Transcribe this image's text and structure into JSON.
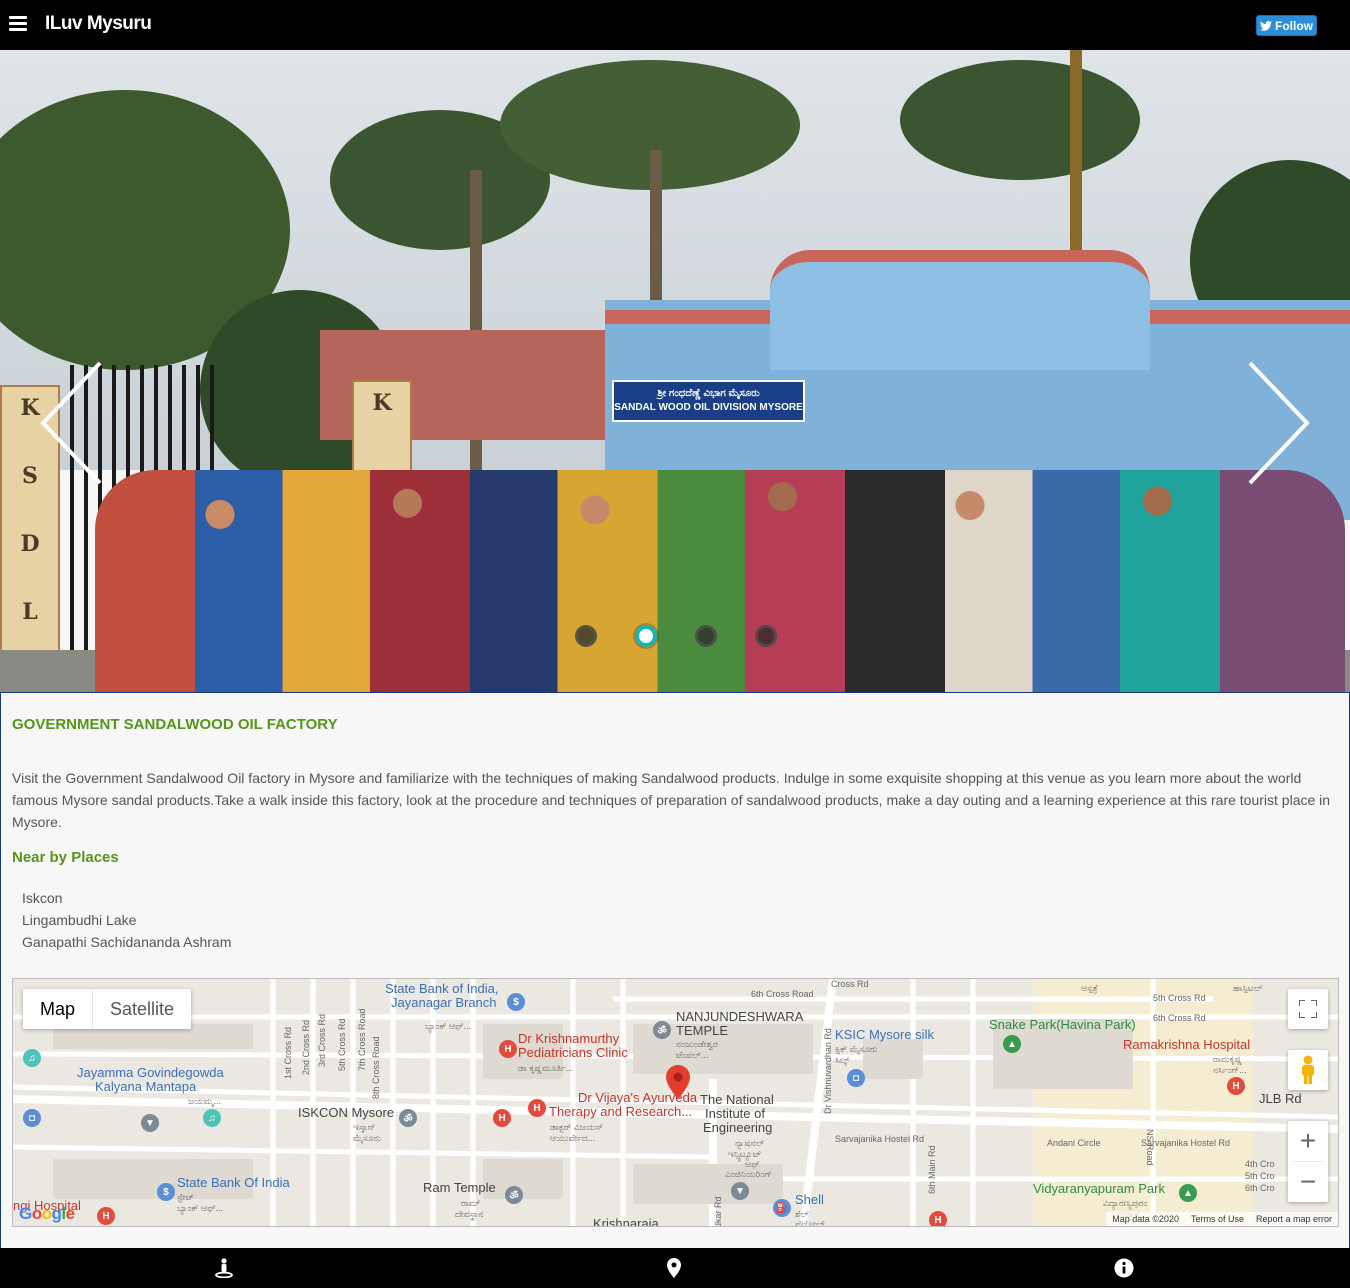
{
  "header": {
    "app_title": "ILuv Mysuru",
    "menu_icon": "hamburger-icon",
    "follow_label": "Follow",
    "follow_icon": "twitter-bird-icon",
    "follow_color": "#2a8fd8"
  },
  "carousel": {
    "sign_line1": "ಶ್ರೀ ಗಂಧದೆಣ್ಣೆ ವಿಭಾಗ ಮೈಸೂರು",
    "sign_line2": "SANDAL WOOD OIL DIVISION MYSORE",
    "pillar_letters": [
      "K",
      "S",
      "D",
      "L"
    ],
    "pillar_letter_right": "K",
    "slide_count": 4,
    "active_slide": 2,
    "accent_color": "#17b4b4"
  },
  "place": {
    "title": "GOVERNMENT SANDALWOOD OIL FACTORY",
    "description": "Visit the Government Sandalwood Oil factory in Mysore and familiarize with the techniques of making Sandalwood products. Indulge in some exquisite shopping at this venue as you learn more about the world famous Mysore sandal products.Take a walk inside this factory, look at the procedure and techniques of preparation of sandalwood products, make a day outing and a learning experience at this rare tourist place in Mysore.",
    "heading_color": "#55951a"
  },
  "nearby": {
    "title": "Near by Places",
    "items": [
      "Iskcon",
      "Lingambudhi Lake",
      "Ganapathi Sachidananda Ashram"
    ]
  },
  "map": {
    "type_map": "Map",
    "type_satellite": "Satellite",
    "zoom_in": "+",
    "zoom_out": "−",
    "footer_data": "Map data ©2020",
    "footer_terms": "Terms of Use",
    "footer_report": "Report a map error",
    "labels": {
      "sbi_jayanagar": "State Bank of India,",
      "sbi_jayanagar2": "Jayanagar Branch",
      "sbi_jayanagar_kn": "ಬ್ಯಾಂಕ್ ಆಫ್...",
      "krishnamurthy1": "Dr Krishnamurthy",
      "krishnamurthy2": "Pediatricians Clinic",
      "krishnamurthy_kn": "ಡಾ ಕೃಷ್ಣಮೂರ್ತಿ...",
      "nanjundeshwara1": "NANJUNDESHWARA",
      "nanjundeshwara2": "TEMPLE",
      "nanjundeshwara_kn1": "ನಂಜುಂಡೇಶ್ವರ",
      "nanjundeshwara_kn2": "ಟೆಂಪಲ್...",
      "ksic1": "KSIC Mysore silk",
      "ksic_kn1": "ಕ್ಸಿಕ್ ಮೈಸೂರು",
      "ksic_kn2": "ಸಿಲ್ಕ್",
      "snake_park": "Snake Park(Havina Park)",
      "ramakrishna": "Ramakrishna Hospital",
      "ramakrishna_kn1": "ರಾಮಕೃಷ್ಣ",
      "ramakrishna_kn2": "ನರ್ಸಿಂಗ್...",
      "jayamma1": "Jayamma Govindegowda",
      "jayamma2": "Kalyana Mantapa",
      "jayamma_kn": "ಜಯಮ್ಮ...",
      "iskcon": "ISKCON Mysore",
      "iskcon_kn1": "ಇಸ್ಕಾನ್",
      "iskcon_kn2": "ಮೈಸೂರು",
      "vijaya1": "Dr Vijaya's Ayurveda",
      "vijaya2": "Therapy and Research...",
      "vijaya_kn1": "ಡಾಕ್ಟರ್ ವಿಜಯಸ್",
      "vijaya_kn2": "ಆಯುರ್ವೇದ...",
      "nie1": "The National",
      "nie2": "Institute of",
      "nie3": "Engineering",
      "nie_kn1": "ನ್ಯಾಷನಲ್",
      "nie_kn2": "ಇನ್ಸ್ಟಿಟ್ಯೂಟ್",
      "nie_kn3": "ಆಫ್",
      "nie_kn4": "ಎಂಜಿನಿಯರಿಂಗ್",
      "jlb": "JLB Rd",
      "sarvajanika1": "Sarvajanika Hostel Rd",
      "sarvajanika2": "Sarvajanika Hostel Rd",
      "andani": "Andani Circle",
      "sbi2": "State Bank Of India",
      "sbi2_kn1": "ಸ್ಟೇಟ್",
      "sbi2_kn2": "ಬ್ಯಾಂಕ್ ಆಫ್...",
      "ram_temple": "Ram Temple",
      "ram_temple_kn1": "ರಾಮ್",
      "ram_temple_kn2": "ದೇವಸ್ಥಾನ",
      "shell": "Shell",
      "shell_kn1": "ಶೆಲ್",
      "shell_kn2": "ಪೆಟ್ರೋಲ್...",
      "vidyaranyapuram": "Vidyaranyapuram Park",
      "vidyaranyapuram_kn": "ವಿದ್ಯಾರಣ್ಯಪುರಂ",
      "vidyaranyapuram_kn2": "ಉದ್ಯಾನ",
      "krishnaraja": "Krishnaraja",
      "hospital_left": "ngi Hospital",
      "road_6th_cross": "6th Cross Road",
      "road_6th_cross_rd": "6th Cross Rd",
      "road_5th_cross": "5th Cross Rd",
      "road_1st_cross": "1st Cross Rd",
      "road_2nd_cross": "2nd Cross Rd",
      "road_3rd_cross": "3rd Cross Rd",
      "road_5th_cross_v": "5th Cross Rd",
      "road_7th_cross": "7th Cross Road",
      "road_8th_cross": "8th Cross Road",
      "road_vishnuvardhan": "Dr Vishnuvardhan Rd",
      "road_6th_main": "6th Main Rd",
      "road_ns": "NS Road",
      "road_4th_cro": "4th Cro",
      "road_5th_cro": "5th Cro",
      "road_6th_cro": "6th Cro",
      "road_kdkar": "dkar Rd",
      "road_cross_rd_top": "Cross Rd",
      "ramakrishna_top_kn": "ಆಸ್ಪತ್ರೆ",
      "hospital_top": "ಹಾಸ್ಪಿಟಲ್"
    }
  },
  "bottom_nav": {
    "items": [
      {
        "icon": "person-pin-icon"
      },
      {
        "icon": "map-marker-icon"
      },
      {
        "icon": "info-circle-icon"
      }
    ]
  }
}
